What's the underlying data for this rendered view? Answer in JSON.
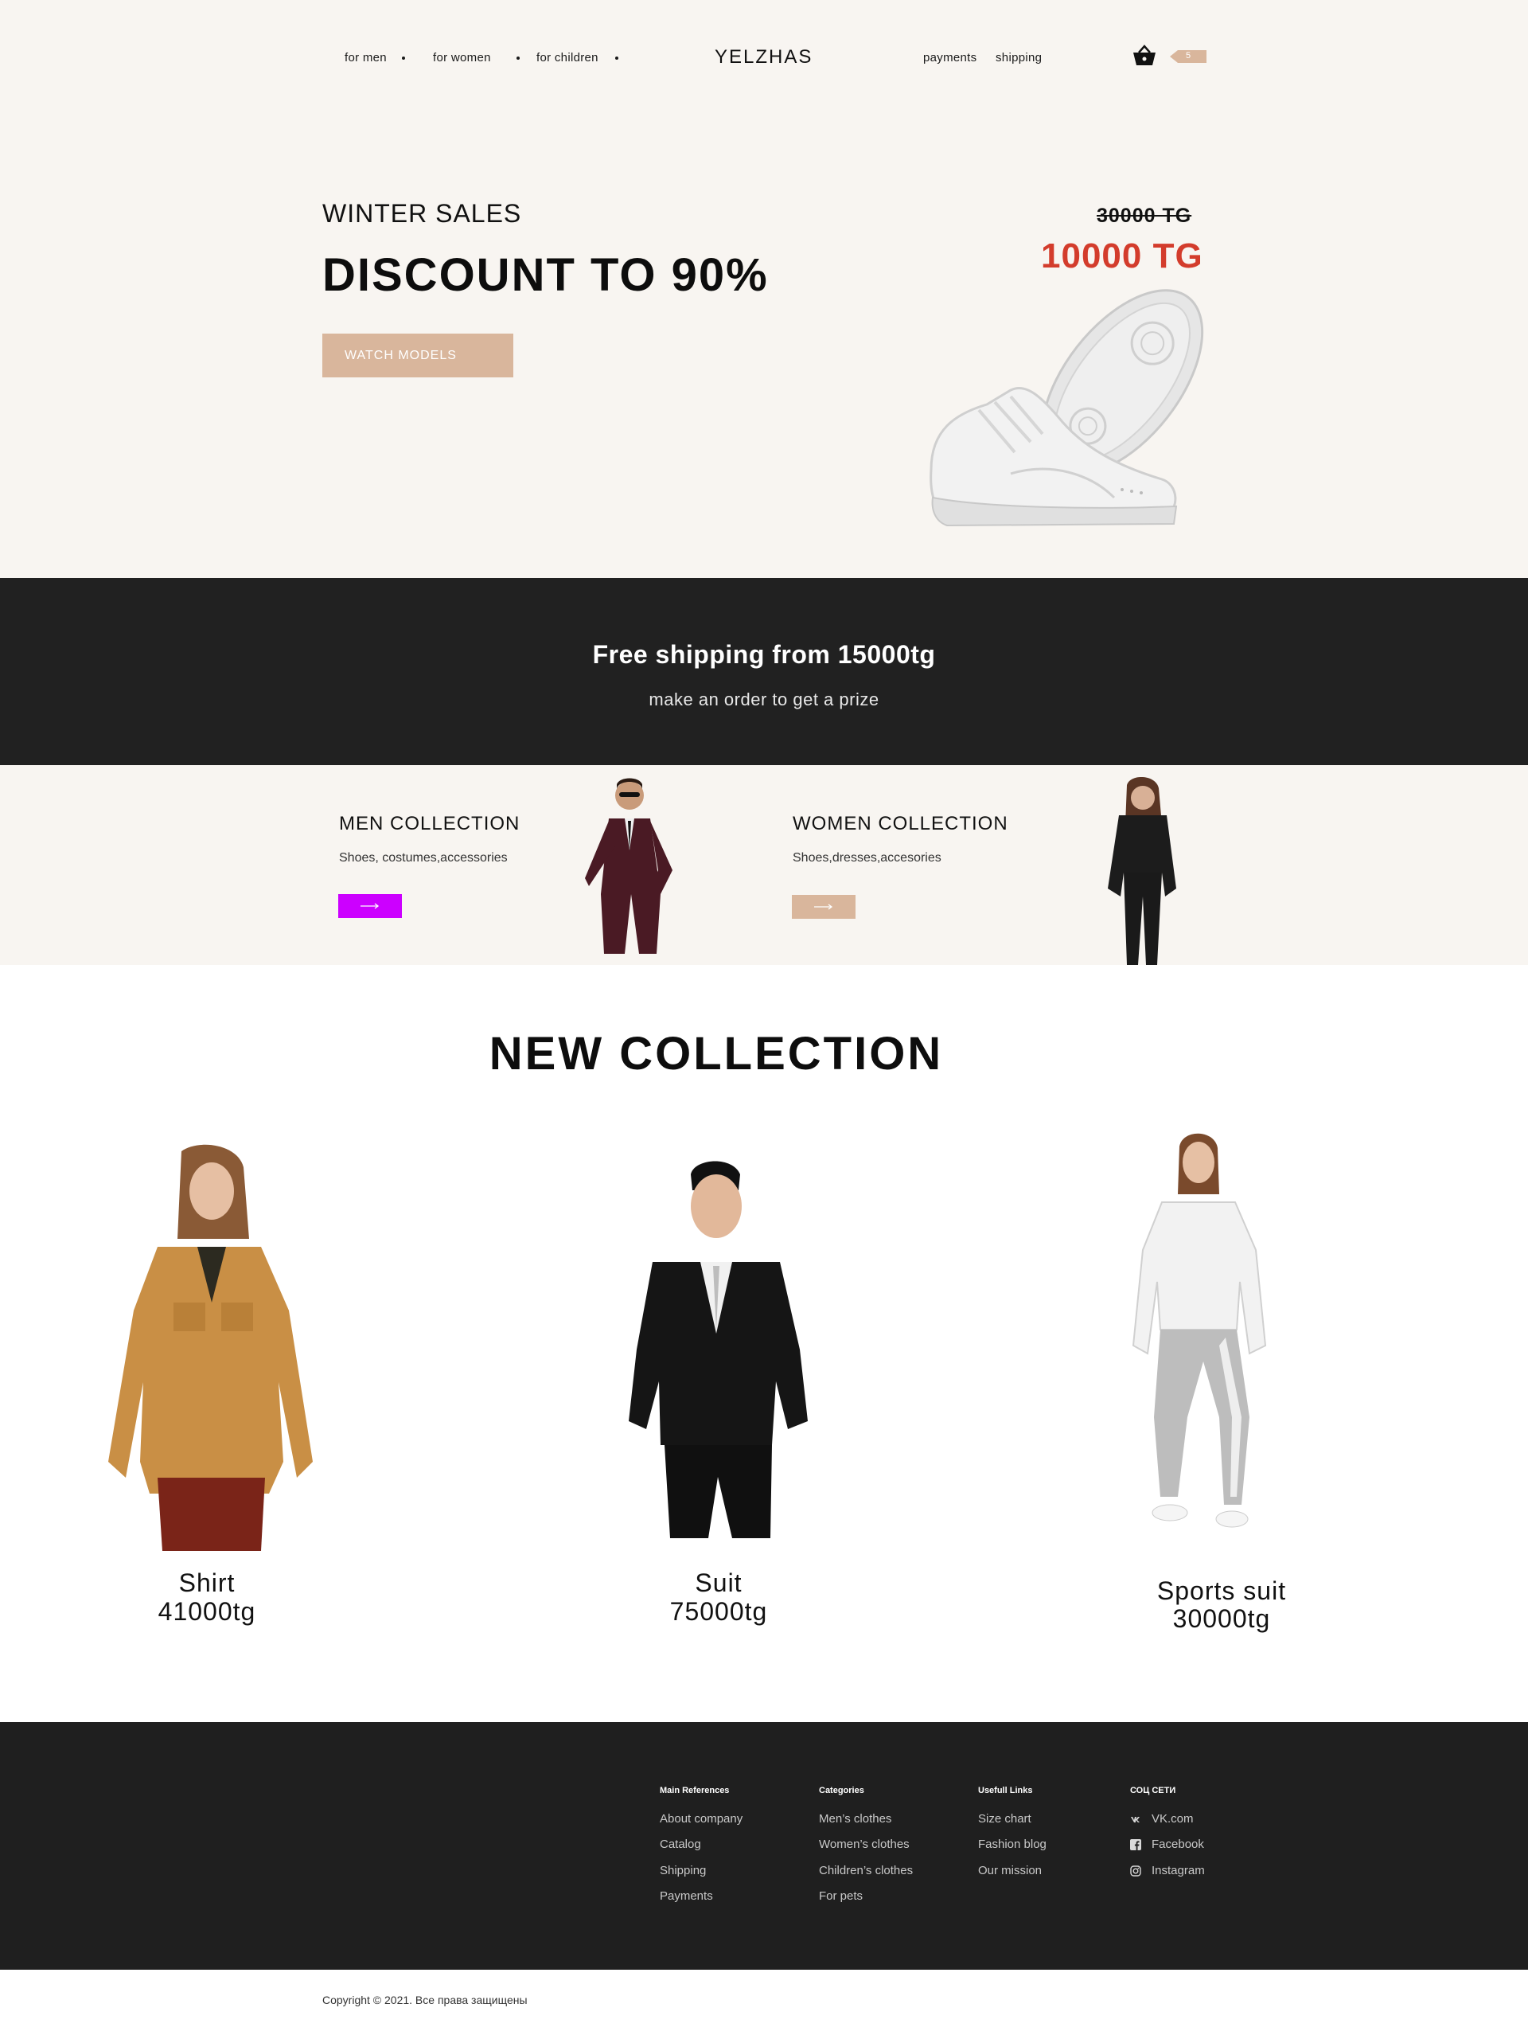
{
  "header": {
    "nav_left": [
      "for men",
      "for women",
      "for children"
    ],
    "logo": "YELZHAS",
    "nav_right": [
      "payments",
      "shipping"
    ],
    "cart_icon": "basket-icon",
    "cart_count": "5"
  },
  "hero": {
    "subtitle": "WINTER SALES",
    "title": "DISCOUNT TO 90%",
    "button": "WATCH MODELS",
    "old_price": "30000 TG",
    "new_price": "10000 TG",
    "image": "white-sneaker"
  },
  "shipping_band": {
    "title": "Free shipping from 15000tg",
    "subtitle": "make an order to get a prize"
  },
  "collections": [
    {
      "title": "MEN COLLECTION",
      "desc": "Shoes, costumes,accessories",
      "button_icon": "arrow-right-icon",
      "button_color": "#cc00ff"
    },
    {
      "title": "WOMEN COLLECTION",
      "desc": "Shoes,dresses,accesories",
      "button_icon": "arrow-right-icon",
      "button_color": "#d9b69c"
    }
  ],
  "new_collection": {
    "title": "NEW COLLECTION",
    "products": [
      {
        "name": "Shirt",
        "price": "41000tg"
      },
      {
        "name": "Suit",
        "price": "75000tg"
      },
      {
        "name": "Sports suit",
        "price": "30000tg"
      }
    ]
  },
  "footer": {
    "columns": [
      {
        "heading": "Main References",
        "links": [
          "About company",
          "Catalog",
          "Shipping",
          "Payments"
        ]
      },
      {
        "heading": "Categories",
        "links": [
          "Men’s clothes",
          "Women’s clothes",
          "Children’s clothes",
          "For pets"
        ]
      },
      {
        "heading": "Usefull Links",
        "links": [
          "Size chart",
          "Fashion blog",
          "Our mission"
        ]
      },
      {
        "heading": "СОЦ СЕТИ",
        "links": [
          "VK.com",
          "Facebook",
          "Instagram"
        ],
        "icons": [
          "vk-icon",
          "facebook-icon",
          "instagram-icon"
        ]
      }
    ],
    "copyright": "Copyright © 2021. Все права защищены"
  },
  "colors": {
    "accent": "#d9b69c",
    "sale": "#d33c2c",
    "dark": "#212121",
    "cream": "#f8f5f1",
    "men_button": "#cc00ff"
  }
}
